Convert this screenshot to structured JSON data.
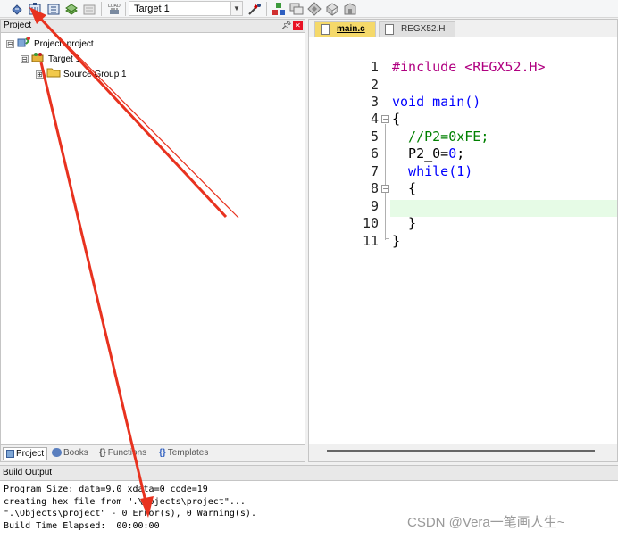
{
  "toolbar": {
    "target_label": "Target 1",
    "buttons": [
      "translate-icon",
      "build-icon",
      "rebuild-icon",
      "batch-build-icon",
      "stop-build-icon",
      "download-icon",
      "target-options-icon",
      "manage-components-icon",
      "file-extensions-icon",
      "select-packs-icon",
      "pack-installer-icon",
      "debug-icon"
    ]
  },
  "project_panel": {
    "title": "Project",
    "tree": [
      {
        "label": "Project: project",
        "icon": "project-icon",
        "expander": "⊟"
      },
      {
        "label": "Target 1",
        "icon": "target-icon",
        "expander": "⊟"
      },
      {
        "label": "Source Group 1",
        "icon": "folder-icon",
        "expander": "⊞"
      }
    ],
    "tabs": [
      {
        "label": "Project",
        "icon": "project-tab-icon"
      },
      {
        "label": "Books",
        "icon": "books-icon"
      },
      {
        "label": "Functions",
        "icon": "{}"
      },
      {
        "label": "Templates",
        "icon": "{}"
      }
    ]
  },
  "editor": {
    "tabs": [
      {
        "label": "main.c",
        "active": true
      },
      {
        "label": "REGX52.H",
        "active": false
      }
    ],
    "line_numbers": [
      "1",
      "2",
      "3",
      "4",
      "5",
      "6",
      "7",
      "8",
      "9",
      "10",
      "11"
    ],
    "lines": [
      "#include <REGX52.H>",
      "",
      "void main()",
      "{",
      "  //P2=0xFE;",
      "  P2_0=0;",
      "  while(1)",
      "  {",
      "",
      "  }",
      "}"
    ],
    "current_line": 9
  },
  "build_output": {
    "title": "Build Output",
    "lines": [
      "Program Size: data=9.0 xdata=0 code=19",
      "creating hex file from \".\\Objects\\project\"...",
      "\".\\Objects\\project\" - 0 Error(s), 0 Warning(s).",
      "Build Time Elapsed:  00:00:00"
    ]
  },
  "watermark": "CSDN @Vera一笔画人生~",
  "colors": {
    "arrow": "#e8321f",
    "active_tab": "#f5d96a",
    "current_line": "#e6fbe6",
    "keyword": "#0000ff",
    "comment": "#008000",
    "include": "#b00080"
  }
}
